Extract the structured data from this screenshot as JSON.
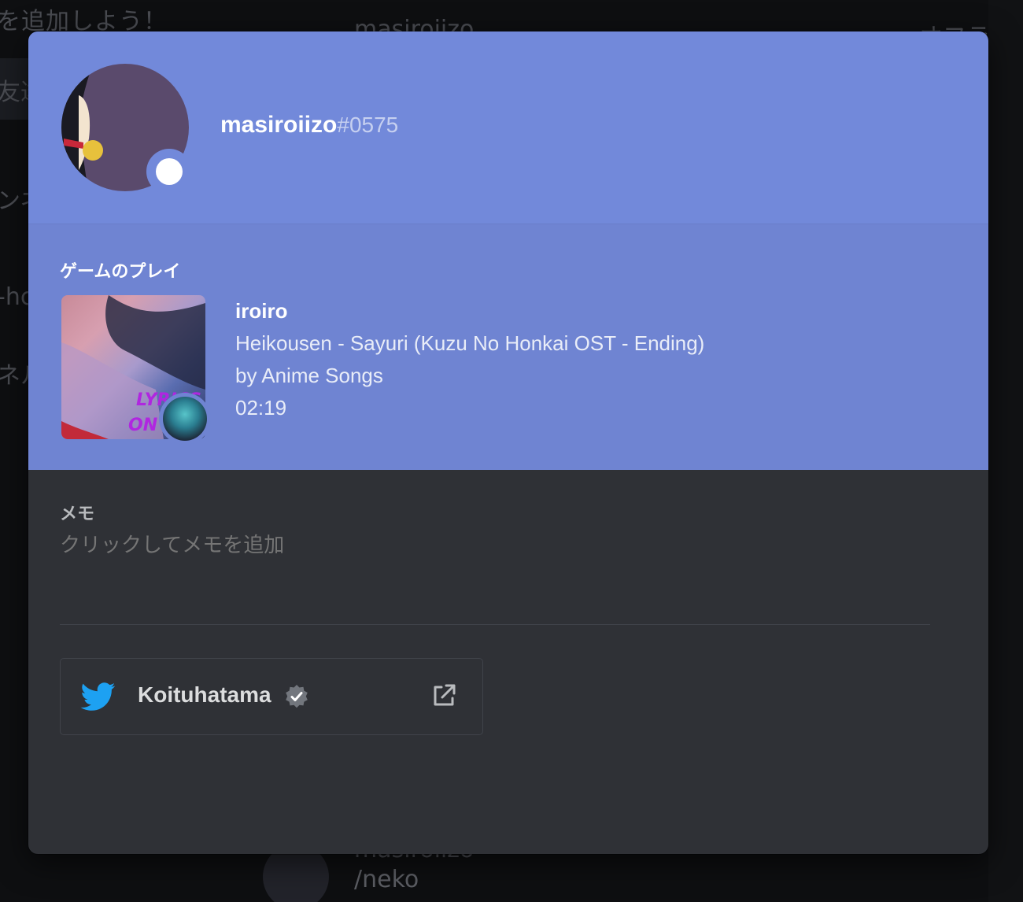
{
  "background": {
    "top_left_text": "を追加しよう！",
    "side_items": [
      "友達",
      "ンネ",
      "-hc",
      "ネル"
    ],
    "user_text": "masiroiizo",
    "top_right_text": "オフライン",
    "bottom_name": "masiroiizo",
    "bottom_command": "/neko"
  },
  "profile": {
    "username": "masiroiizo",
    "discriminator": "#0575",
    "status": "online",
    "colors": {
      "header": "#7289da",
      "activity": "#6f84d2",
      "body": "#2f3136"
    }
  },
  "activity": {
    "heading": "ゲームのプレイ",
    "name": "iroiro",
    "details": "Heikousen - Sayuri (Kuzu No Honkai OST - Ending)",
    "state": "by Anime Songs",
    "elapsed": "02:19",
    "art_text": "LYRICS ON"
  },
  "memo": {
    "label": "メモ",
    "placeholder": "クリックしてメモを追加"
  },
  "connected_account": {
    "platform_icon": "twitter-icon",
    "name": "Koituhatama",
    "verified": true,
    "twitter_color": "#1da1f2"
  }
}
